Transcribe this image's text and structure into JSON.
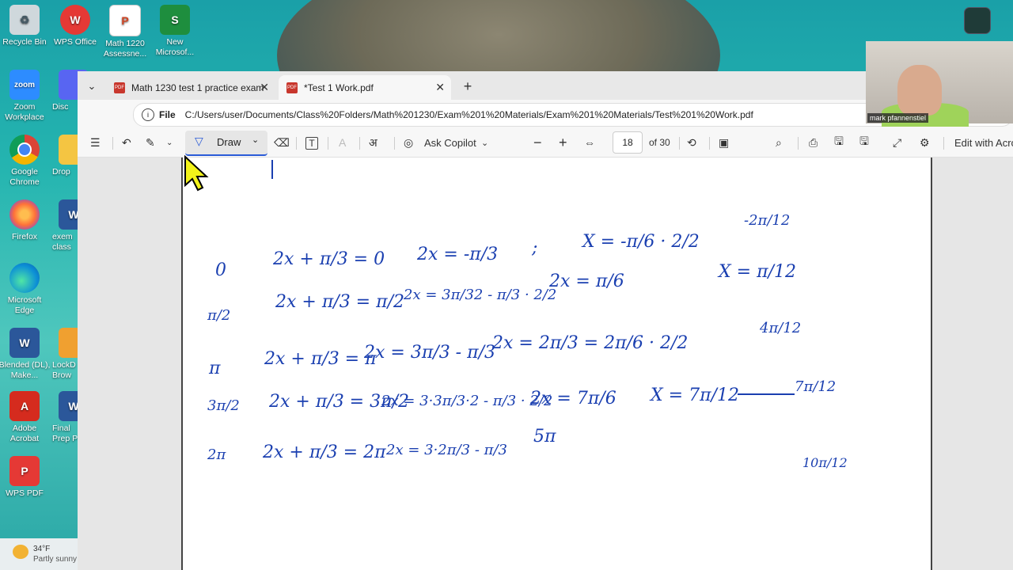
{
  "desktop": {
    "icons": [
      {
        "label": "Recycle Bin",
        "color": "#cfd8dc",
        "glyph": "♻"
      },
      {
        "label": "WPS Office",
        "color": "#e53935",
        "glyph": "W"
      },
      {
        "label": "Math 1220 Assessne...",
        "color": "#ffffff",
        "glyph": "P"
      },
      {
        "label": "New Microsof...",
        "color": "#1e8e3e",
        "glyph": "S"
      },
      {
        "label": "Zoom Workplace",
        "color": "#2d8cff",
        "glyph": "zoom"
      },
      {
        "label": "Disc",
        "color": "#5865f2",
        "glyph": ""
      },
      {
        "label": "Google Chrome",
        "color": "#4285f4",
        "glyph": "●"
      },
      {
        "label": "Drop",
        "color": "#f4c542",
        "glyph": ""
      },
      {
        "label": "Firefox",
        "color": "#ff7139",
        "glyph": "●"
      },
      {
        "label": "exem class",
        "color": "#2b579a",
        "glyph": "W"
      },
      {
        "label": "Microsoft Edge",
        "color": "#0c8fd6",
        "glyph": "●"
      },
      {
        "label": "Blended (DL), Make...",
        "color": "#2b579a",
        "glyph": "W"
      },
      {
        "label": "LockD Brow",
        "color": "#f0a030",
        "glyph": ""
      },
      {
        "label": "Adobe Acrobat",
        "color": "#d52b1e",
        "glyph": "A"
      },
      {
        "label": "Final Prep P",
        "color": "#2b579a",
        "glyph": "W"
      },
      {
        "label": "WPS PDF",
        "color": "#e53935",
        "glyph": "P"
      }
    ],
    "weather": {
      "temp": "34°F",
      "condition": "Partly sunny"
    }
  },
  "browser": {
    "tabs": [
      {
        "title": "Math 1230 test 1 practice exam Sp",
        "active": false
      },
      {
        "title": "*Test 1 Work.pdf",
        "active": true
      }
    ],
    "address": {
      "scheme_label": "File",
      "url": "C:/Users/user/Documents/Class%20Folders/Math%201230/Exam%201%20Materials/Exam%201%20Materials/Test%201%20Work.pdf"
    },
    "toolbar": {
      "draw_label": "Draw",
      "copilot_label": "Ask Copilot",
      "page_current": "18",
      "page_total": "of 30",
      "edit_label": "Edit with Acro"
    }
  },
  "webcam": {
    "name": "mark pfannenstiel"
  },
  "handwriting": {
    "row1": {
      "angle": "0",
      "eq1": "2x + π/3 = 0",
      "eq2": "2x = -π/3",
      "sep": ";",
      "eq3": "X = -π/6 · 2/2",
      "eq4": "-2π/12"
    },
    "row2": {
      "angle": "π/2",
      "eq1": "2x + π/3 = π/2",
      "eq2": "2x = 3π/32 - π/3 · 2/2",
      "eq3": "2x = π/6",
      "eq4": "X = π/12"
    },
    "row3": {
      "angle": "π",
      "eq1": "2x + π/3 = π",
      "eq2": "2x = 3π/3 - π/3",
      "eq3": "2x = 2π/3 = 2π/6 · 2/2",
      "eq4": "4π/12"
    },
    "row4": {
      "angle": "3π/2",
      "eq1": "2x + π/3 = 3π/2",
      "eq2": "2x = 3·3π/3·2 - π/3 · 2/2",
      "eq3": "2x = 7π/6",
      "eq4": "X = 7π/12",
      "eq5": "7π/12"
    },
    "row5": {
      "angle": "2π",
      "eq1": "2x + π/3 = 2π",
      "eq2": "2x = 3·2π/3 - π/3",
      "eq3": "5π",
      "eq4": "10π/12"
    }
  }
}
